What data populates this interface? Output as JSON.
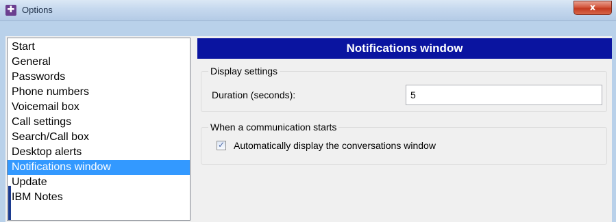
{
  "window": {
    "title": "Options",
    "icon": "options-app-icon",
    "close_icon": "close-icon",
    "close_glyph": "x"
  },
  "sidebar": {
    "items": [
      {
        "label": "Start",
        "selected": false
      },
      {
        "label": "General",
        "selected": false
      },
      {
        "label": "Passwords",
        "selected": false
      },
      {
        "label": "Phone numbers",
        "selected": false
      },
      {
        "label": "Voicemail box",
        "selected": false
      },
      {
        "label": "Call settings",
        "selected": false
      },
      {
        "label": "Search/Call box",
        "selected": false
      },
      {
        "label": "Desktop alerts",
        "selected": false
      },
      {
        "label": "Notifications window",
        "selected": true
      },
      {
        "label": "Update",
        "selected": false
      },
      {
        "label": "IBM Notes",
        "selected": false
      }
    ]
  },
  "panel": {
    "header": "Notifications window",
    "display_settings": {
      "title": "Display settings",
      "duration_label": "Duration (seconds):",
      "duration_value": "5"
    },
    "communication": {
      "title": "When a communication starts",
      "auto_display_label": "Automatically display the conversations window",
      "auto_display_checked": true
    }
  },
  "colors": {
    "header_bg": "#0a14a0",
    "selection": "#3399ff",
    "window_frame": "#b9d1ea",
    "close_button": "#c43b22"
  }
}
